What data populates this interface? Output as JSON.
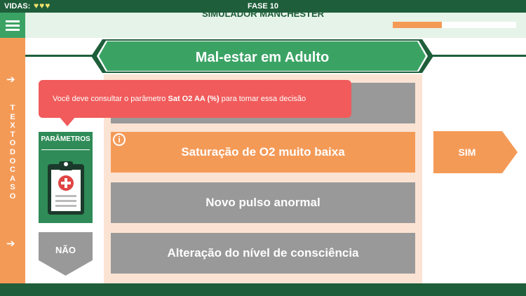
{
  "status": {
    "lives_label": "VIDAS:",
    "hearts": "♥♥♥",
    "phase": "FASE 10"
  },
  "header": {
    "title": "SIMULADOR MANCHESTER",
    "progress_fraction": 0.4,
    "progress_color": "#f49a57"
  },
  "case_panel": {
    "label": "TEXTO DO CASO",
    "label_letters": "TEXTODOCASO",
    "arrow": "➔"
  },
  "banner": {
    "title": "Mal-estar em Adulto"
  },
  "tooltip": {
    "prefix": "Você deve consultar o parâmetro ",
    "parameter": "Sat O2 AA (%)",
    "suffix": " para tomar essa decisão"
  },
  "parameters": {
    "label": "PARÂMETROS",
    "icon": "clipboard-medical-icon"
  },
  "options": [
    {
      "label": "",
      "state": "default"
    },
    {
      "label": "Saturação de O2 muito baixa",
      "state": "selected"
    },
    {
      "label": "Novo pulso anormal",
      "state": "default"
    },
    {
      "label": "Alteração do nível de consciência",
      "state": "default"
    }
  ],
  "info_icon_glyph": "i",
  "buttons": {
    "yes": "SIM",
    "no": "NÃO"
  },
  "colors": {
    "dark_green": "#1e5e3a",
    "green": "#3aa364",
    "orange": "#f49a57",
    "gray": "#999999",
    "red": "#f15b5b",
    "peach": "#fbe3d3"
  }
}
